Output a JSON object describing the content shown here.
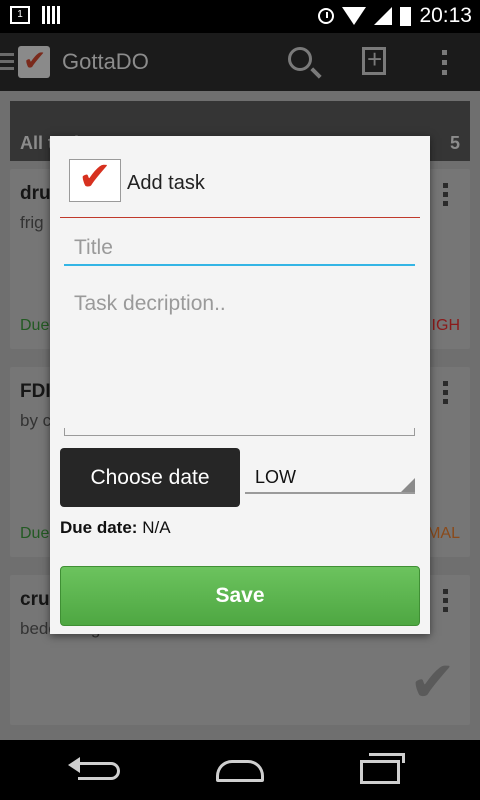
{
  "status_bar": {
    "time": "20:13",
    "notification_badge": "1",
    "icons": [
      "notification-icon",
      "sd-card-icon",
      "alarm-icon",
      "wifi-icon",
      "signal-icon",
      "battery-charging-icon"
    ]
  },
  "app_bar": {
    "title": "GottaDO",
    "icons": [
      "menu-icon",
      "app-logo-icon",
      "search-icon",
      "add-task-icon",
      "overflow-menu-icon"
    ]
  },
  "list": {
    "header_title": "All tasks",
    "count": "5",
    "cards": [
      {
        "title": "dru",
        "description": "frig",
        "due_label": "Due",
        "priority": "IGH",
        "priority_color": "#8b1a1a"
      },
      {
        "title": "FDI",
        "description": "by c",
        "due_label": "Due",
        "priority": "MAL",
        "priority_color": "#8a4a1a"
      },
      {
        "title": "cru",
        "description": "bedevilling school bunch",
        "due_label": "",
        "priority": "",
        "priority_color": "#5a5a5a"
      }
    ]
  },
  "dialog": {
    "title": "Add task",
    "title_input": {
      "value": "",
      "placeholder": "Title"
    },
    "description_input": {
      "value": "",
      "placeholder": "Task decription.."
    },
    "choose_date_label": "Choose date",
    "priority_selected": "LOW",
    "due_date_label": "Due date:",
    "due_date_value": "N/A",
    "save_label": "Save",
    "colors": {
      "accent_underline": "#33b5e5",
      "divider": "#c0392b",
      "save_green": "#5cb54e",
      "check_red": "#d7311f"
    }
  },
  "nav_bar": {
    "icons": [
      "back-icon",
      "home-icon",
      "recent-apps-icon"
    ]
  }
}
